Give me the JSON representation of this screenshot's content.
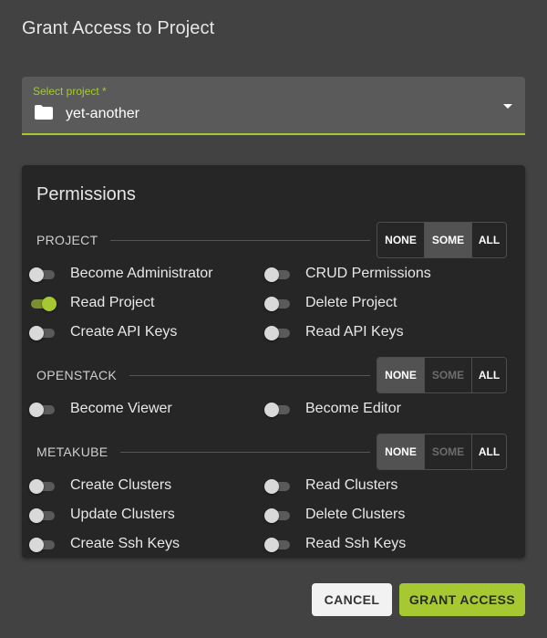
{
  "dialog": {
    "title": "Grant Access to Project"
  },
  "project_select": {
    "label": "Select project *",
    "value": "yet-another",
    "icon": "folder-icon"
  },
  "permissions": {
    "title": "Permissions",
    "sections": [
      {
        "name": "PROJECT",
        "options": [
          "NONE",
          "SOME",
          "ALL"
        ],
        "selected": "SOME",
        "items": [
          {
            "label": "Become Administrator",
            "enabled": false
          },
          {
            "label": "CRUD Permissions",
            "enabled": false
          },
          {
            "label": "Read Project",
            "enabled": true
          },
          {
            "label": "Delete Project",
            "enabled": false
          },
          {
            "label": "Create API Keys",
            "enabled": false
          },
          {
            "label": "Read API Keys",
            "enabled": false
          }
        ]
      },
      {
        "name": "OPENSTACK",
        "options": [
          "NONE",
          "SOME",
          "ALL"
        ],
        "selected": "NONE",
        "items": [
          {
            "label": "Become Viewer",
            "enabled": false
          },
          {
            "label": "Become Editor",
            "enabled": false
          }
        ]
      },
      {
        "name": "METAKUBE",
        "options": [
          "NONE",
          "SOME",
          "ALL"
        ],
        "selected": "NONE",
        "items": [
          {
            "label": "Create Clusters",
            "enabled": false
          },
          {
            "label": "Read Clusters",
            "enabled": false
          },
          {
            "label": "Update Clusters",
            "enabled": false
          },
          {
            "label": "Delete Clusters",
            "enabled": false
          },
          {
            "label": "Create Ssh Keys",
            "enabled": false
          },
          {
            "label": "Read Ssh Keys",
            "enabled": false
          }
        ]
      }
    ]
  },
  "actions": {
    "cancel_label": "CANCEL",
    "grant_label": "GRANT ACCESS"
  },
  "colors": {
    "accent": "#a6c932",
    "dialog_bg": "#424242",
    "card_bg": "#262626"
  }
}
